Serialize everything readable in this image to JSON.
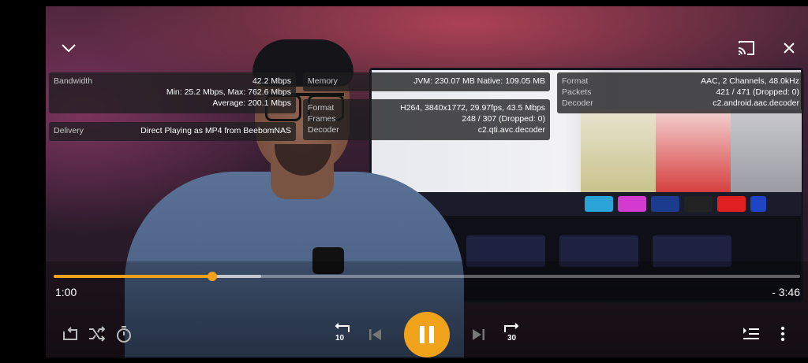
{
  "top_bar": {
    "collapse_icon": "chevron-down-icon",
    "cast_icon": "cast-icon",
    "close_icon": "close-icon"
  },
  "stats": {
    "bandwidth": {
      "label": "Bandwidth",
      "current": "42.2 Mbps",
      "min_max": "Min: 25.2 Mbps, Max: 762.6 Mbps",
      "average": "Average: 200.1 Mbps"
    },
    "delivery": {
      "label": "Delivery",
      "value": "Direct Playing as MP4 from BeebomNAS"
    },
    "memory": {
      "label": "Memory",
      "value": "JVM: 230.07 MB Native: 109.05 MB"
    },
    "video": {
      "format_label": "Format",
      "format_value": "H264, 3840x1772, 29.97fps, 43.5 Mbps",
      "frames_label": "Frames",
      "frames_value": "248 / 307 (Dropped: 0)",
      "decoder_label": "Decoder",
      "decoder_value": "c2.qti.avc.decoder"
    },
    "audio": {
      "format_label": "Format",
      "format_value": "AAC, 2 Channels, 48.0kHz",
      "packets_label": "Packets",
      "packets_value": "421 / 471 (Dropped: 0)",
      "decoder_label": "Decoder",
      "decoder_value": "c2.android.aac.decoder"
    }
  },
  "playback": {
    "elapsed": "1:00",
    "remaining": "- 3:46",
    "progress_fraction": 0.212,
    "buffered_fraction": 0.278,
    "accent_color": "#f0a31a"
  },
  "controls": {
    "rewind_seconds": "10",
    "forward_seconds": "30",
    "left_icons": [
      "repeat-icon",
      "shuffle-icon",
      "sleep-timer-icon"
    ],
    "center_icons": [
      "rewind-10-icon",
      "previous-icon",
      "pause-icon",
      "next-icon",
      "forward-30-icon"
    ],
    "right_icons": [
      "queue-icon",
      "more-options-icon"
    ]
  }
}
